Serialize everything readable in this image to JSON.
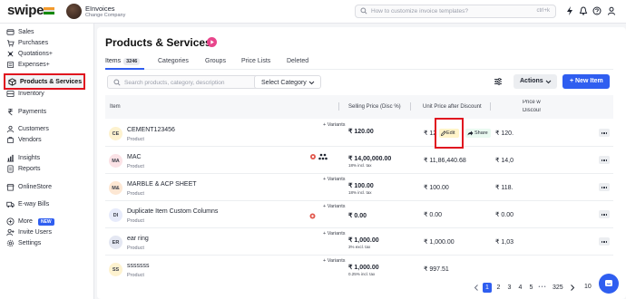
{
  "app": {
    "logo": "swipe",
    "company_name": "EInvoices",
    "change_company": "Change Company",
    "search_placeholder": "How to customize invoice templates?",
    "search_shortcut": "ctrl+k"
  },
  "sidebar": {
    "items": [
      {
        "label": "Sales",
        "icon": "sales-icon"
      },
      {
        "label": "Purchases",
        "icon": "cart-icon"
      },
      {
        "label": "Quotations+",
        "icon": "quotation-icon"
      },
      {
        "label": "Expenses+",
        "icon": "expenses-icon"
      },
      {
        "label": "Products & Services",
        "icon": "box-icon"
      },
      {
        "label": "Inventory",
        "icon": "inventory-icon"
      },
      {
        "label": "Payments",
        "icon": "rupee-icon"
      },
      {
        "label": "Customers",
        "icon": "customers-icon"
      },
      {
        "label": "Vendors",
        "icon": "vendors-icon"
      },
      {
        "label": "Insights",
        "icon": "insights-icon"
      },
      {
        "label": "Reports",
        "icon": "reports-icon"
      },
      {
        "label": "OnlineStore",
        "icon": "store-icon"
      },
      {
        "label": "E-way Bills",
        "icon": "truck-icon"
      },
      {
        "label": "More",
        "icon": "more-icon",
        "badge": "NEW"
      },
      {
        "label": "Invite Users",
        "icon": "invite-icon"
      },
      {
        "label": "Settings",
        "icon": "settings-icon"
      }
    ]
  },
  "main": {
    "title": "Products & Services",
    "tabs": [
      {
        "label": "Items",
        "count": "3246"
      },
      {
        "label": "Categories"
      },
      {
        "label": "Groups"
      },
      {
        "label": "Price Lists"
      },
      {
        "label": "Deleted"
      }
    ],
    "search_placeholder": "Search products, category, description",
    "select_category": "Select Category",
    "actions_label": "Actions",
    "new_item_label": "+ New Item",
    "edit_label": "Edit",
    "share_label": "Share"
  },
  "table": {
    "headers": {
      "item": "Item",
      "selling_price": "Selling Price (Disc %)",
      "unit_price": "Unit Price after Discount",
      "price_disc_line1": "Price w",
      "price_disc_line2": "Discoun"
    },
    "rows": [
      {
        "initials": "CE",
        "name": "CEMENT123456",
        "category": "Product",
        "variants": "+ Variants",
        "price": "₹ 120.00",
        "tax_note": "",
        "unit": "₹ 120.00",
        "price_disc": "₹ 120.",
        "avatar_color": "#fdf2cf"
      },
      {
        "initials": "MA",
        "name": "MAC",
        "category": "Product",
        "variants": "",
        "price": "₹ 14,00,000.00",
        "tax_note": "18% incl. tax",
        "unit": "₹ 11,86,440.68",
        "price_disc": "₹ 14,0",
        "avatar_color": "#fbe2e6"
      },
      {
        "initials": "M&",
        "name": "MARBLE & ACP SHEET",
        "category": "Product",
        "variants": "+ Variants",
        "price": "₹ 100.00",
        "tax_note": "18% incl. tax",
        "unit": "₹ 100.00",
        "price_disc": "₹ 118.",
        "avatar_color": "#fde7d3"
      },
      {
        "initials": "DI",
        "name": "Duplicate Item Custom Columns",
        "category": "Product",
        "variants": "+ Variants",
        "price": "₹ 0.00",
        "tax_note": "",
        "unit": "₹ 0.00",
        "price_disc": "₹ 0.00",
        "avatar_color": "#e7ebfb"
      },
      {
        "initials": "ER",
        "name": "ear ring",
        "category": "Product",
        "variants": "+ Variants",
        "price": "₹ 1,000.00",
        "tax_note": "3% excl. tax",
        "unit": "₹ 1,000.00",
        "price_disc": "₹ 1,03",
        "avatar_color": "#e4e7f2"
      },
      {
        "initials": "SS",
        "name": "sssssss",
        "category": "Product",
        "variants": "+ Variants",
        "price": "₹ 1,000.00",
        "tax_note": "0.25% incl. tax",
        "unit": "₹ 997.51",
        "price_disc": "",
        "avatar_color": "#fdf2cf"
      }
    ]
  },
  "pagination": {
    "pages": [
      "1",
      "2",
      "3",
      "4",
      "5",
      "325"
    ],
    "ellipsis": "• • •",
    "active": "1",
    "page_size": "10"
  }
}
